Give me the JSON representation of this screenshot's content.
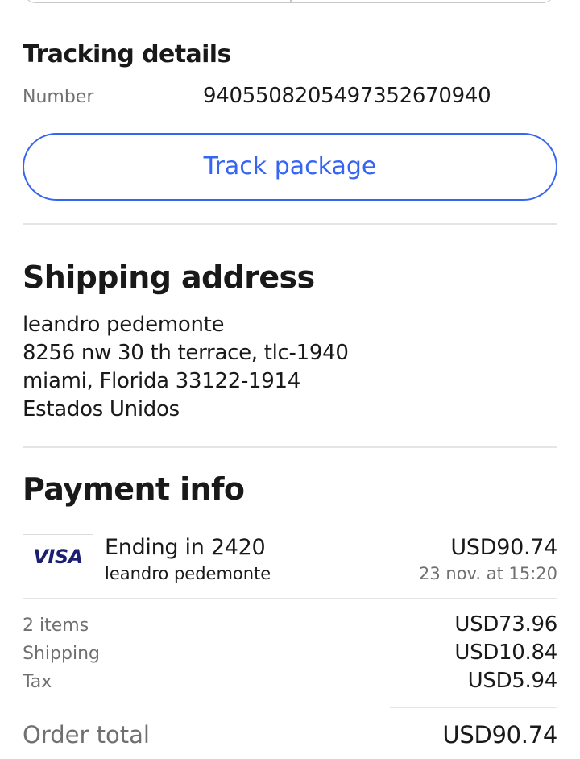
{
  "tracking": {
    "title": "Tracking details",
    "number_label": "Number",
    "number_value": "9405508205497352670940",
    "button_label": "Track package"
  },
  "shipping": {
    "title": "Shipping address",
    "lines": [
      "leandro pedemonte",
      "8256 nw 30 th terrace, tlc-1940",
      "miami, Florida 33122-1914",
      "Estados Unidos"
    ]
  },
  "payment": {
    "title": "Payment info",
    "card_brand": "VISA",
    "ending": "Ending in 2420",
    "holder": "leandro pedemonte",
    "amount": "USD90.74",
    "date": "23 nov. at 15:20"
  },
  "summary": {
    "items": [
      {
        "label": "2 items",
        "value": "USD73.96"
      },
      {
        "label": "Shipping",
        "value": "USD10.84"
      },
      {
        "label": "Tax",
        "value": "USD5.94"
      }
    ],
    "total_label": "Order total",
    "total_value": "USD90.74"
  },
  "colors": {
    "accent": "#3665f3",
    "text": "#191919",
    "muted": "#707070",
    "divider": "#e5e5e5",
    "visa": "#1a1f71"
  }
}
